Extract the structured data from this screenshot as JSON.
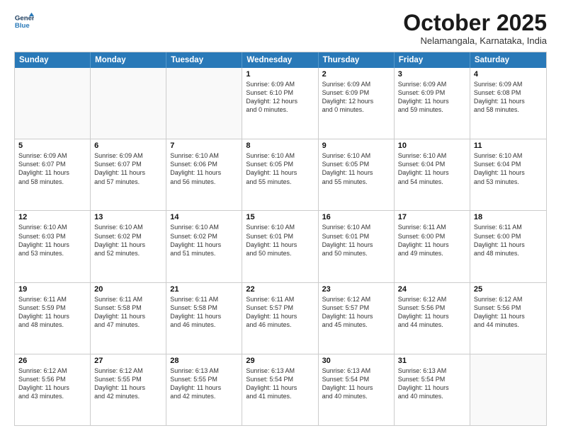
{
  "header": {
    "logo_line1": "General",
    "logo_line2": "Blue",
    "month": "October 2025",
    "location": "Nelamangala, Karnataka, India"
  },
  "weekdays": [
    "Sunday",
    "Monday",
    "Tuesday",
    "Wednesday",
    "Thursday",
    "Friday",
    "Saturday"
  ],
  "rows": [
    [
      {
        "day": "",
        "lines": []
      },
      {
        "day": "",
        "lines": []
      },
      {
        "day": "",
        "lines": []
      },
      {
        "day": "1",
        "lines": [
          "Sunrise: 6:09 AM",
          "Sunset: 6:10 PM",
          "Daylight: 12 hours",
          "and 0 minutes."
        ]
      },
      {
        "day": "2",
        "lines": [
          "Sunrise: 6:09 AM",
          "Sunset: 6:09 PM",
          "Daylight: 12 hours",
          "and 0 minutes."
        ]
      },
      {
        "day": "3",
        "lines": [
          "Sunrise: 6:09 AM",
          "Sunset: 6:09 PM",
          "Daylight: 11 hours",
          "and 59 minutes."
        ]
      },
      {
        "day": "4",
        "lines": [
          "Sunrise: 6:09 AM",
          "Sunset: 6:08 PM",
          "Daylight: 11 hours",
          "and 58 minutes."
        ]
      }
    ],
    [
      {
        "day": "5",
        "lines": [
          "Sunrise: 6:09 AM",
          "Sunset: 6:07 PM",
          "Daylight: 11 hours",
          "and 58 minutes."
        ]
      },
      {
        "day": "6",
        "lines": [
          "Sunrise: 6:09 AM",
          "Sunset: 6:07 PM",
          "Daylight: 11 hours",
          "and 57 minutes."
        ]
      },
      {
        "day": "7",
        "lines": [
          "Sunrise: 6:10 AM",
          "Sunset: 6:06 PM",
          "Daylight: 11 hours",
          "and 56 minutes."
        ]
      },
      {
        "day": "8",
        "lines": [
          "Sunrise: 6:10 AM",
          "Sunset: 6:05 PM",
          "Daylight: 11 hours",
          "and 55 minutes."
        ]
      },
      {
        "day": "9",
        "lines": [
          "Sunrise: 6:10 AM",
          "Sunset: 6:05 PM",
          "Daylight: 11 hours",
          "and 55 minutes."
        ]
      },
      {
        "day": "10",
        "lines": [
          "Sunrise: 6:10 AM",
          "Sunset: 6:04 PM",
          "Daylight: 11 hours",
          "and 54 minutes."
        ]
      },
      {
        "day": "11",
        "lines": [
          "Sunrise: 6:10 AM",
          "Sunset: 6:04 PM",
          "Daylight: 11 hours",
          "and 53 minutes."
        ]
      }
    ],
    [
      {
        "day": "12",
        "lines": [
          "Sunrise: 6:10 AM",
          "Sunset: 6:03 PM",
          "Daylight: 11 hours",
          "and 53 minutes."
        ]
      },
      {
        "day": "13",
        "lines": [
          "Sunrise: 6:10 AM",
          "Sunset: 6:02 PM",
          "Daylight: 11 hours",
          "and 52 minutes."
        ]
      },
      {
        "day": "14",
        "lines": [
          "Sunrise: 6:10 AM",
          "Sunset: 6:02 PM",
          "Daylight: 11 hours",
          "and 51 minutes."
        ]
      },
      {
        "day": "15",
        "lines": [
          "Sunrise: 6:10 AM",
          "Sunset: 6:01 PM",
          "Daylight: 11 hours",
          "and 50 minutes."
        ]
      },
      {
        "day": "16",
        "lines": [
          "Sunrise: 6:10 AM",
          "Sunset: 6:01 PM",
          "Daylight: 11 hours",
          "and 50 minutes."
        ]
      },
      {
        "day": "17",
        "lines": [
          "Sunrise: 6:11 AM",
          "Sunset: 6:00 PM",
          "Daylight: 11 hours",
          "and 49 minutes."
        ]
      },
      {
        "day": "18",
        "lines": [
          "Sunrise: 6:11 AM",
          "Sunset: 6:00 PM",
          "Daylight: 11 hours",
          "and 48 minutes."
        ]
      }
    ],
    [
      {
        "day": "19",
        "lines": [
          "Sunrise: 6:11 AM",
          "Sunset: 5:59 PM",
          "Daylight: 11 hours",
          "and 48 minutes."
        ]
      },
      {
        "day": "20",
        "lines": [
          "Sunrise: 6:11 AM",
          "Sunset: 5:58 PM",
          "Daylight: 11 hours",
          "and 47 minutes."
        ]
      },
      {
        "day": "21",
        "lines": [
          "Sunrise: 6:11 AM",
          "Sunset: 5:58 PM",
          "Daylight: 11 hours",
          "and 46 minutes."
        ]
      },
      {
        "day": "22",
        "lines": [
          "Sunrise: 6:11 AM",
          "Sunset: 5:57 PM",
          "Daylight: 11 hours",
          "and 46 minutes."
        ]
      },
      {
        "day": "23",
        "lines": [
          "Sunrise: 6:12 AM",
          "Sunset: 5:57 PM",
          "Daylight: 11 hours",
          "and 45 minutes."
        ]
      },
      {
        "day": "24",
        "lines": [
          "Sunrise: 6:12 AM",
          "Sunset: 5:56 PM",
          "Daylight: 11 hours",
          "and 44 minutes."
        ]
      },
      {
        "day": "25",
        "lines": [
          "Sunrise: 6:12 AM",
          "Sunset: 5:56 PM",
          "Daylight: 11 hours",
          "and 44 minutes."
        ]
      }
    ],
    [
      {
        "day": "26",
        "lines": [
          "Sunrise: 6:12 AM",
          "Sunset: 5:56 PM",
          "Daylight: 11 hours",
          "and 43 minutes."
        ]
      },
      {
        "day": "27",
        "lines": [
          "Sunrise: 6:12 AM",
          "Sunset: 5:55 PM",
          "Daylight: 11 hours",
          "and 42 minutes."
        ]
      },
      {
        "day": "28",
        "lines": [
          "Sunrise: 6:13 AM",
          "Sunset: 5:55 PM",
          "Daylight: 11 hours",
          "and 42 minutes."
        ]
      },
      {
        "day": "29",
        "lines": [
          "Sunrise: 6:13 AM",
          "Sunset: 5:54 PM",
          "Daylight: 11 hours",
          "and 41 minutes."
        ]
      },
      {
        "day": "30",
        "lines": [
          "Sunrise: 6:13 AM",
          "Sunset: 5:54 PM",
          "Daylight: 11 hours",
          "and 40 minutes."
        ]
      },
      {
        "day": "31",
        "lines": [
          "Sunrise: 6:13 AM",
          "Sunset: 5:54 PM",
          "Daylight: 11 hours",
          "and 40 minutes."
        ]
      },
      {
        "day": "",
        "lines": []
      }
    ]
  ]
}
